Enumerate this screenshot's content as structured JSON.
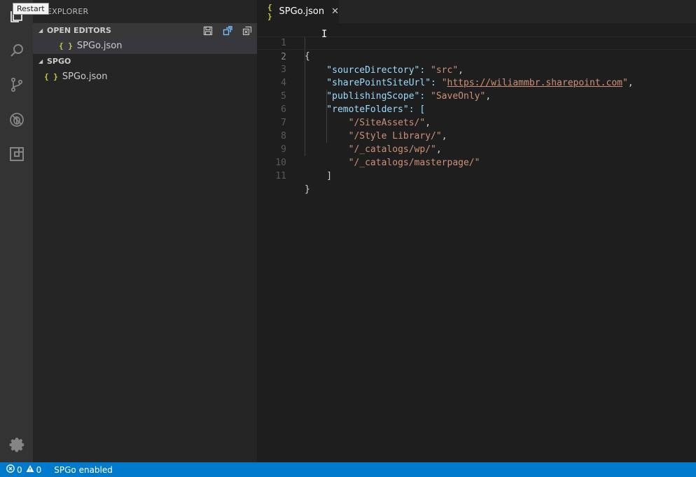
{
  "tooltip": {
    "text": "Restart"
  },
  "activity_bar": {
    "items": [
      {
        "icon": "files-icon",
        "active": true
      },
      {
        "icon": "search-icon",
        "active": false
      },
      {
        "icon": "source-control-icon",
        "active": false
      },
      {
        "icon": "debug-icon",
        "active": false
      },
      {
        "icon": "extensions-icon",
        "active": false
      }
    ],
    "settings_icon": "gear-icon"
  },
  "sidebar": {
    "title": "EXPLORER",
    "open_editors": {
      "label": "OPEN EDITORS",
      "actions": [
        "save-all-icon",
        "collapse-all-icon",
        "close-all-icon"
      ],
      "files": [
        {
          "badge": "{ }",
          "name": "SPGo.json"
        }
      ]
    },
    "folder": {
      "label": "SPGO",
      "files": [
        {
          "badge": "{ }",
          "name": "SPGo.json"
        }
      ]
    }
  },
  "editor": {
    "tab": {
      "badge": "{ }",
      "label": "SPGo.json",
      "close": "✕"
    },
    "line_numbers": [
      "1",
      "2",
      "3",
      "4",
      "5",
      "6",
      "7",
      "8",
      "9",
      "10",
      "11"
    ],
    "lines": [
      [
        "{"
      ],
      [
        "    \"",
        "sourceDirectory",
        "\": ",
        "\"src\"",
        ","
      ],
      [
        "    \"",
        "sharePointSiteUrl",
        "\": ",
        "\"",
        "https://wiliammbr.sharepoint.com",
        "\"",
        ","
      ],
      [
        "    \"",
        "publishingScope",
        "\": ",
        "\"SaveOnly\"",
        ","
      ],
      [
        "    \"",
        "remoteFolders",
        "\": ["
      ],
      [
        "        ",
        "\"/SiteAssets/\"",
        ","
      ],
      [
        "        ",
        "\"/Style Library/\"",
        ","
      ],
      [
        "        ",
        "\"/_catalogs/wp/\"",
        ","
      ],
      [
        "        ",
        "\"/_catalogs/masterpage/\""
      ],
      [
        "    ]"
      ],
      [
        "}"
      ]
    ]
  },
  "status_bar": {
    "errors": "0",
    "warnings": "0",
    "message": "SPGo enabled"
  },
  "colors": {
    "activity_bar": "#333333",
    "sidebar": "#252526",
    "editor": "#1e1e1e",
    "status_bar": "#007acc",
    "json_key": "#9cdcfe",
    "json_string": "#ce9178",
    "json_badge": "#cbcb41"
  }
}
